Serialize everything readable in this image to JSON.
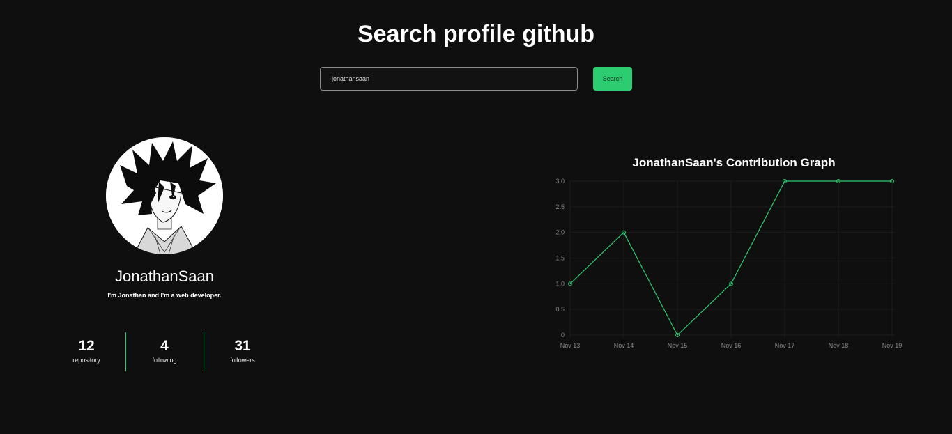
{
  "page": {
    "title": "Search profile github"
  },
  "search": {
    "value": "jonathansaan",
    "button_label": "Search"
  },
  "profile": {
    "avatar_icon": "anime-avatar-illustration",
    "name": "JonathanSaan",
    "bio": "I'm Jonathan and I'm a web developer.",
    "stats": [
      {
        "value": "12",
        "label": "repository"
      },
      {
        "value": "4",
        "label": "following"
      },
      {
        "value": "31",
        "label": "followers"
      }
    ]
  },
  "colors": {
    "accent": "#2ecc71",
    "background": "#0f0f0f",
    "axis_text": "#8a8a8a"
  },
  "chart_data": {
    "type": "line",
    "title": "JonathanSaan's Contribution Graph",
    "categories": [
      "Nov 13",
      "Nov 14",
      "Nov 15",
      "Nov 16",
      "Nov 17",
      "Nov 18",
      "Nov 19"
    ],
    "values": [
      1,
      2,
      0,
      1,
      3,
      3,
      3
    ],
    "yticks": [
      "0",
      "0.5",
      "1.0",
      "1.5",
      "2.0",
      "2.5",
      "3.0"
    ],
    "ylim": [
      0,
      3
    ],
    "grid": true,
    "legend": "none"
  }
}
